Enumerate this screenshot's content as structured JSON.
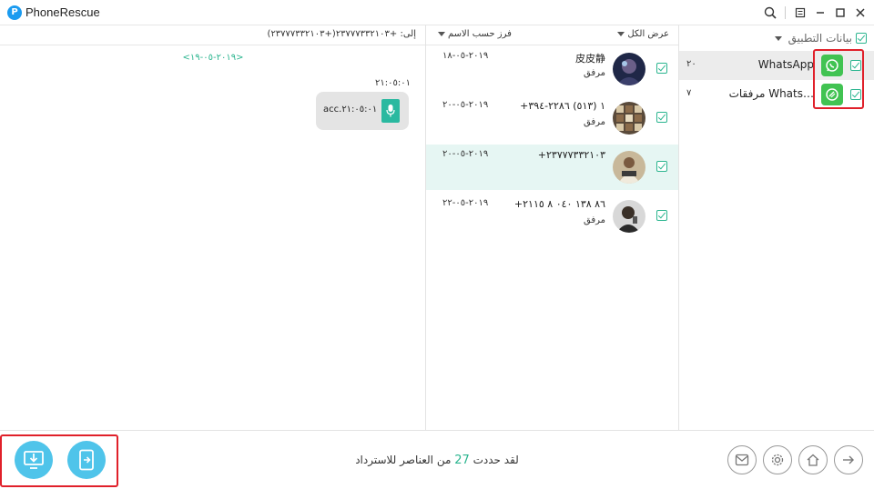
{
  "window": {
    "logo_letter": "P",
    "title": "PhoneRescue"
  },
  "chat": {
    "to_line": "إلى: +٢٣٧٧٧٣٣٢١٠٣(+٢٣٧٧٧٣٣٢١٠٣)",
    "date_link": "<٢٠١٩-٠٥-١٩>",
    "message_time": "٢١:٠٥:٠١",
    "bubble_text": "acc.٢١:٠٥:٠١"
  },
  "conversations": {
    "show_all": "عرض الكل",
    "sort_by": "فرز حسب الاسم",
    "items": [
      {
        "name": "皮皮静",
        "sub": "مرفق",
        "date": "٢٠١٩-٠٥-١٨"
      },
      {
        "name": "+١ (٥١٣) ٢٢٨٦-٣٩٤",
        "sub": "مرفق",
        "date": "٢٠١٩-٠٥-٢٠"
      },
      {
        "name": "+٢٣٧٧٧٣٣٢١٠٣",
        "sub": "",
        "date": "٢٠١٩-٠٥-٢٠"
      },
      {
        "name": "+٨٦ ١٣٨ ٠٤٠ ٨ ٢١١٥",
        "sub": "مرفق",
        "date": "٢٠١٩-٠٥-٢٢"
      }
    ]
  },
  "categories": {
    "title": "بيانات التطبيق",
    "items": [
      {
        "label": "WhatsApp",
        "count": "٢٠"
      },
      {
        "label": "مرفقات Whats…",
        "count": "٧"
      }
    ]
  },
  "bottom": {
    "text_before": "لقد حددت",
    "count": "27",
    "text_after": "من العناصر للاسترداد"
  },
  "colors": {
    "accent": "#2bb58f",
    "highlight": "#e0202a",
    "whatsapp": "#41c352",
    "button_blue": "#4fc4ea"
  },
  "icons": [
    "search-icon",
    "menu-icon",
    "minimize-icon",
    "maximize-icon",
    "close-icon",
    "to-computer-icon",
    "to-device-icon",
    "feedback-icon",
    "settings-icon",
    "home-icon",
    "next-icon"
  ]
}
